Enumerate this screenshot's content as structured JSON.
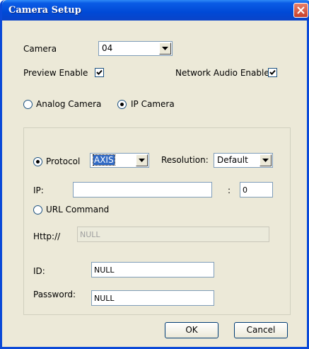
{
  "window": {
    "title": "Camera Setup"
  },
  "camera": {
    "label": "Camera",
    "value": "04"
  },
  "preview": {
    "label": "Preview Enable",
    "checked": true
  },
  "network_audio": {
    "label": "Network Audio Enable",
    "checked": true
  },
  "camera_type": {
    "analog_label": "Analog Camera",
    "ip_label": "IP Camera",
    "selected": "IP Camera"
  },
  "protocol": {
    "label": "Protocol",
    "value": "AXIS",
    "selected": true
  },
  "resolution": {
    "label": "Resolution:",
    "value": "Default"
  },
  "ip": {
    "label": "IP:",
    "value": "",
    "separator": ":",
    "port": "0"
  },
  "url_command": {
    "label": "URL Command",
    "selected": false
  },
  "http": {
    "label": "Http://",
    "value": "NULL"
  },
  "id": {
    "label": "ID:",
    "value": "NULL"
  },
  "password": {
    "label": "Password:",
    "value": "NULL"
  },
  "buttons": {
    "ok": "OK",
    "cancel": "Cancel"
  },
  "colors": {
    "titlebar": "#0a5ce6",
    "dialog_bg": "#ece9d8",
    "selection": "#316ac5"
  }
}
